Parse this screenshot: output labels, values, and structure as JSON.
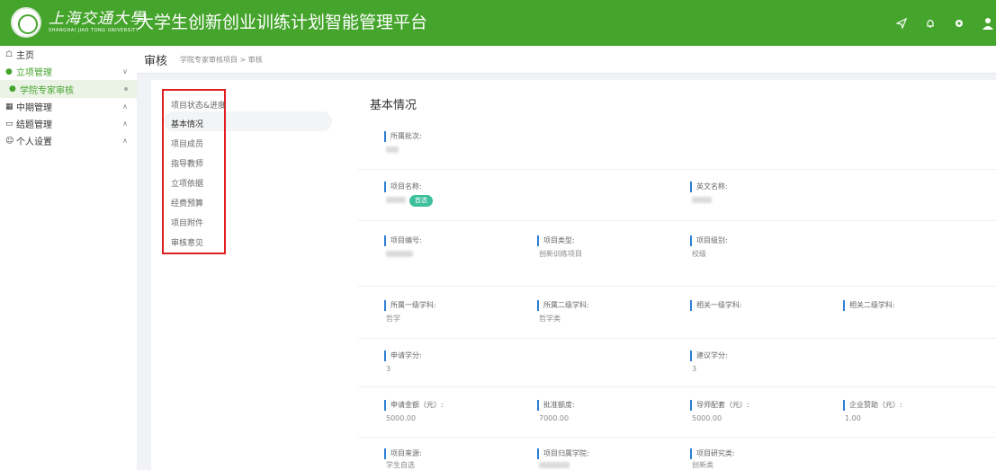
{
  "logo": {
    "cn": "上海交通大學",
    "en": "SHANGHAI JIAO TONG UNIVERSITY"
  },
  "app_title": "大学生创新创业训练计划智能管理平台",
  "top_icons": [
    "send-icon",
    "bell-icon",
    "gear-icon",
    "user-icon"
  ],
  "sidebar": {
    "home": "主页",
    "project": "立项管理",
    "sub": "学院专家审核",
    "mid": "中期管理",
    "final": "结题管理",
    "personal": "个人设置"
  },
  "header": {
    "title": "审核",
    "breadcrumb": "学院专家审核项目 > 审核"
  },
  "left_nav": [
    "项目状态&进度",
    "基本情况",
    "项目成员",
    "指导教师",
    "立项依据",
    "经费预算",
    "项目附件",
    "审核意见"
  ],
  "section_title": "基本情况",
  "fields": {
    "batch": {
      "label": "所属批次:",
      "value": ""
    },
    "name": {
      "label": "项目名称:",
      "value": "",
      "tag": "首选"
    },
    "en_name": {
      "label": "英文名称:",
      "value": ""
    },
    "code": {
      "label": "项目编号:",
      "value": ""
    },
    "type": {
      "label": "项目类型:",
      "value": "创新训练项目"
    },
    "level": {
      "label": "项目级别:",
      "value": "校级"
    },
    "d1": {
      "label": "所属一级学科:",
      "value": "哲学"
    },
    "d2": {
      "label": "所属二级学科:",
      "value": "哲学类"
    },
    "r1": {
      "label": "相关一级学科:",
      "value": ""
    },
    "r2": {
      "label": "相关二级学科:",
      "value": ""
    },
    "credit_apply": {
      "label": "申请学分:",
      "value": "3"
    },
    "credit_suggest": {
      "label": "建议学分:",
      "value": "3"
    },
    "amount": {
      "label": "申请金额（元）:",
      "value": "5000.00"
    },
    "approved": {
      "label": "批准额度:",
      "value": "7000.00"
    },
    "match": {
      "label": "导师配套（元）:",
      "value": "5000.00"
    },
    "sponsor": {
      "label": "企业赞助（元）:",
      "value": "1.00"
    },
    "source": {
      "label": "项目来源:",
      "value": "学生自选"
    },
    "college": {
      "label": "项目归属学院:",
      "value": ""
    },
    "research": {
      "label": "项目研究类:",
      "value": "创新类"
    }
  }
}
